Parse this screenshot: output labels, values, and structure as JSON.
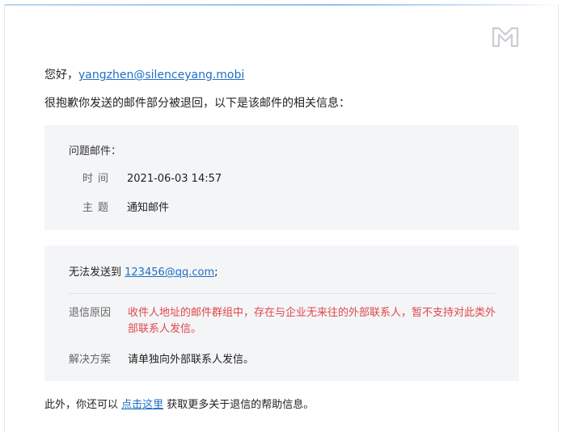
{
  "greeting": {
    "prefix": "您好，",
    "email": "yangzhen@silenceyang.mobi"
  },
  "intro": "很抱歉你发送的邮件部分被退回，以下是该邮件的相关信息：",
  "info": {
    "title": "问题邮件：",
    "time_label": "时间",
    "time_value": "2021-06-03 14:57",
    "subject_label": "主题",
    "subject_value": "通知邮件"
  },
  "failure": {
    "prefix": "无法发送到 ",
    "recipient": "123456@qq.com",
    "suffix": ";",
    "reason_label": "退信原因",
    "reason_text": "收件人地址的邮件群组中，存在与企业无来往的外部联系人，暂不支持对此类外部联系人发信。",
    "solution_label": "解决方案",
    "solution_text": "请单独向外部联系人发信。"
  },
  "footer": {
    "prefix": "此外，你还可以 ",
    "link": "点击这里",
    "suffix": " 获取更多关于退信的帮助信息。"
  },
  "icons": {
    "logo": "brand-logo-icon"
  },
  "colors": {
    "link": "#1f6fc4",
    "error": "#e0474c",
    "panel": "#f4f5f7"
  }
}
